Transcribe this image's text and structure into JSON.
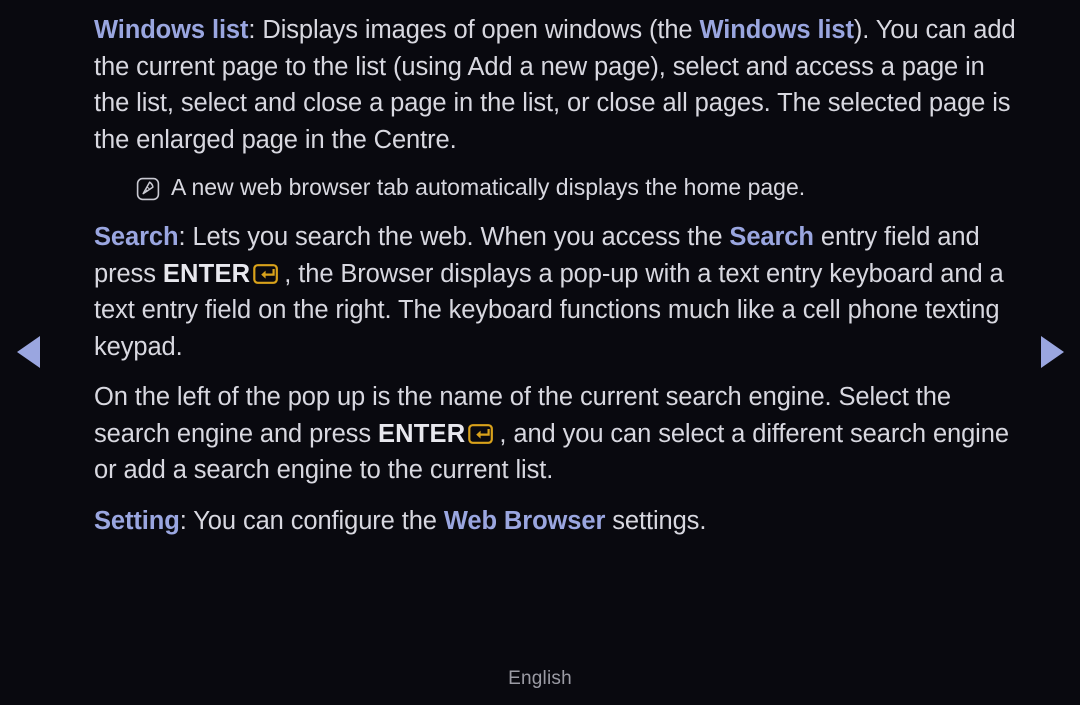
{
  "page": {
    "background_color": "#09090f",
    "keyword_color": "#9aa6e0",
    "body_text_color": "#d8d8e0",
    "enter_key_color": "#d9a21b"
  },
  "nav": {
    "prev_icon": "triangle-left-icon",
    "next_icon": "triangle-right-icon"
  },
  "paragraphs": {
    "windows_list": {
      "keyword": "Windows list",
      "text_a": ": Displays images of open windows (the ",
      "keyword_inline": "Windows list",
      "text_b": "). You can add the current page to the list (using Add a new page), select and access a page in the list, select and close a page in the list, or close all pages. The selected page is the enlarged page in the Centre."
    },
    "note": {
      "icon": "note-pencil-icon",
      "text": "A new web browser tab automatically displays the home page."
    },
    "search": {
      "keyword": "Search",
      "text_a": ": Lets you search the web. When you access the ",
      "keyword_inline": "Search",
      "text_b": " entry field and press ",
      "enter_label": "ENTER",
      "enter_icon": "enter-key-icon",
      "text_c": ", the Browser displays a pop-up with a text entry keyboard and a text entry field on the right. The keyboard functions much like a cell phone texting keypad."
    },
    "search_engine": {
      "text_a": "On the left of the pop up is the name of the current search engine. Select the search engine and press ",
      "enter_label": "ENTER",
      "enter_icon": "enter-key-icon",
      "text_b": ", and you can select a different search engine or add a search engine to the current list."
    },
    "setting": {
      "keyword": "Setting",
      "text_a": ": You can configure the ",
      "keyword_inline": "Web Browser",
      "text_b": " settings."
    }
  },
  "footer": {
    "language": "English"
  }
}
